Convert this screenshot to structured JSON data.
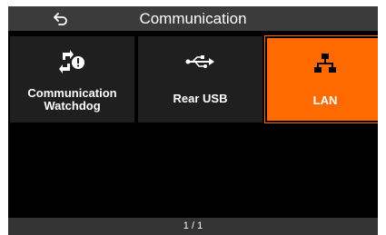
{
  "header": {
    "title": "Communication",
    "back_icon": "back-arrow-icon"
  },
  "tiles": [
    {
      "label_line1": "Communication",
      "label_line2": "Watchdog",
      "icon": "watchdog-icon",
      "selected": false
    },
    {
      "label": "Rear USB",
      "icon": "usb-icon",
      "selected": false
    },
    {
      "label": "LAN",
      "icon": "network-icon",
      "selected": true
    }
  ],
  "footer": {
    "page_indicator": "1 / 1"
  },
  "colors": {
    "accent": "#ff6a00",
    "tile_bg": "#1f1f1f",
    "titlebar_bg": "#3b3b3b",
    "footer_bg": "#333333",
    "screen_bg": "#000000"
  }
}
